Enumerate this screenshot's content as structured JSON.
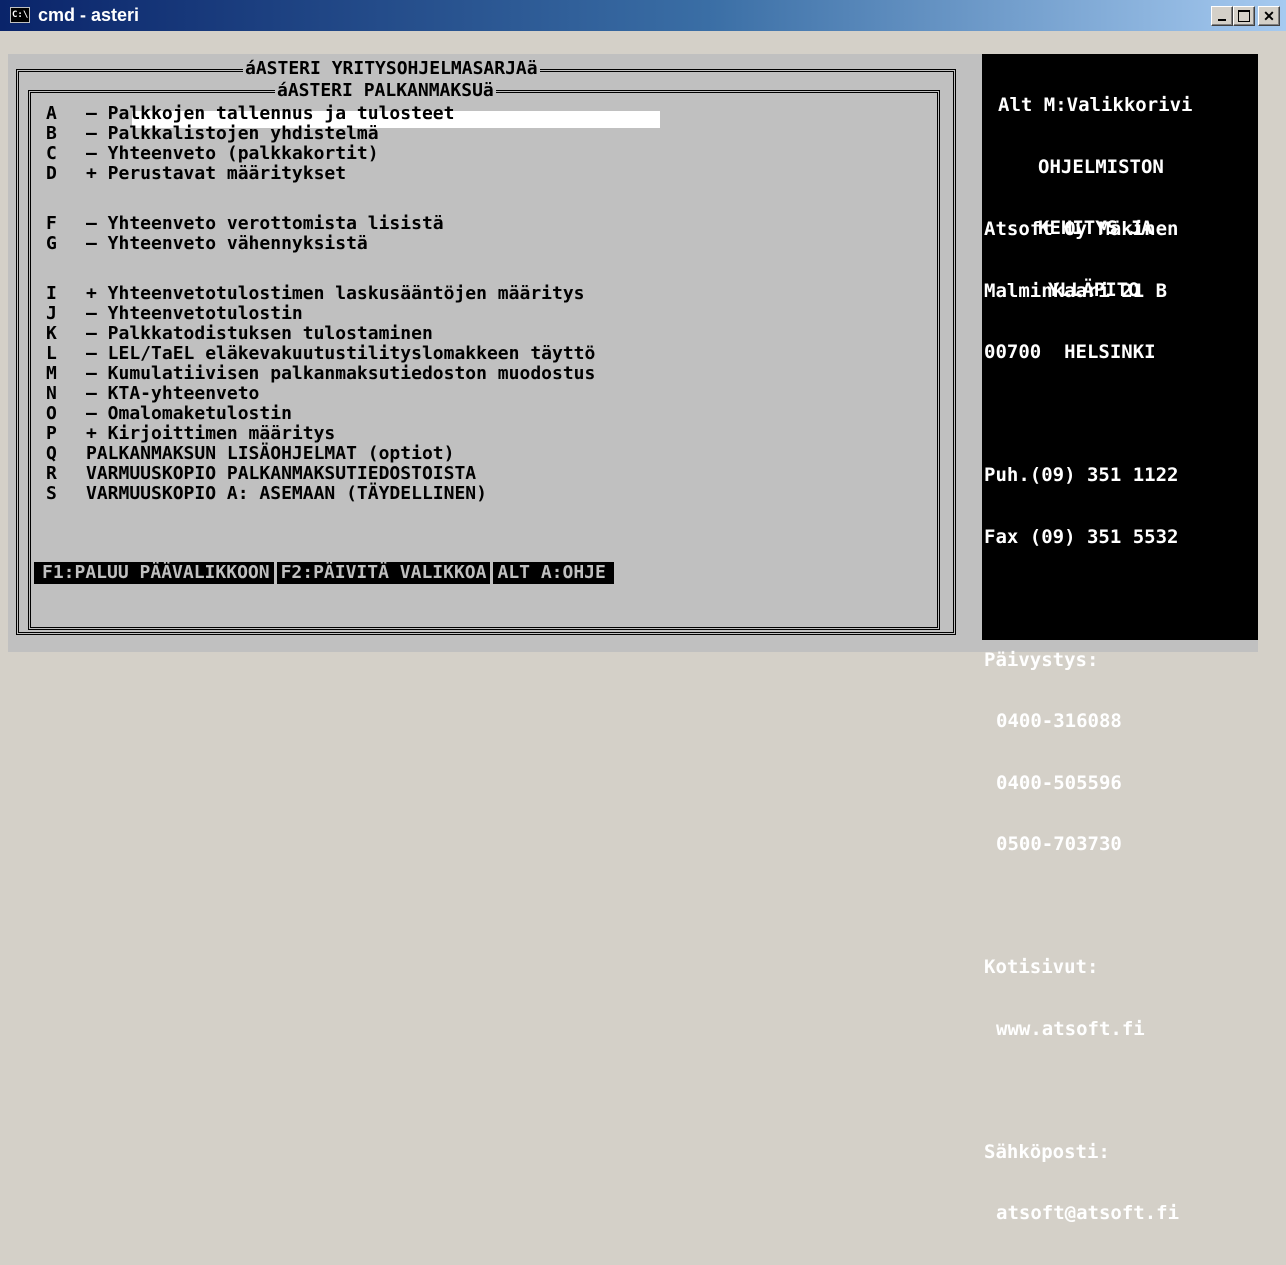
{
  "window": {
    "title": "cmd - asteri",
    "icon": "C:\\",
    "minimize_icon": "minimize-icon",
    "maximize_icon": "maximize-icon",
    "close_label": "✕"
  },
  "menu": {
    "outer_title": "áASTERI YRITYSOHJELMASARJAä",
    "inner_title": "áASTERI PALKANMAKSUä",
    "items": [
      {
        "key": "A",
        "text": "– Palkkojen tallennus ja tulosteet"
      },
      {
        "key": "B",
        "text": "– Palkkalistojen yhdistelmä"
      },
      {
        "key": "C",
        "text": "– Yhteenveto (palkkakortit)"
      },
      {
        "key": "D",
        "text": "+ Perustavat määritykset"
      },
      {
        "key": "F",
        "text": "– Yhteenveto verottomista lisistä"
      },
      {
        "key": "G",
        "text": "– Yhteenveto vähennyksistä"
      },
      {
        "key": "I",
        "text": "+ Yhteenvetotulostimen laskusääntöjen määritys"
      },
      {
        "key": "J",
        "text": "– Yhteenvetotulostin"
      },
      {
        "key": "K",
        "text": "– Palkkatodistuksen tulostaminen"
      },
      {
        "key": "L",
        "text": "– LEL/TaEL eläkevakuutustilityslomakkeen täyttö"
      },
      {
        "key": "M",
        "text": "– Kumulatiivisen palkanmaksutiedoston muodostus"
      },
      {
        "key": "N",
        "text": "– KTA-yhteenveto"
      },
      {
        "key": "O",
        "text": "– Omalomaketulostin"
      },
      {
        "key": "P",
        "text": "+ Kirjoittimen määritys"
      },
      {
        "key": "Q",
        "text": "PALKANMAKSUN LISÄOHJELMAT (optiot)"
      },
      {
        "key": "R",
        "text": "VARMUUSKOPIO PALKANMAKSUTIEDOSTOISTA"
      },
      {
        "key": "S",
        "text": "VARMUUSKOPIO A: ASEMAAN (TÄYDELLINEN)"
      }
    ],
    "function_keys": [
      "F1:PALUU PÄÄVALIKKOON",
      "F2:PÄIVITÄ VALIKKOA",
      "ALT A:OHJE"
    ]
  },
  "info": {
    "menubar_hint": "Alt M:Valikkorivi",
    "slogan": [
      "OHJELMISTON",
      "KEHITYS JA",
      "YLLÄPITO"
    ],
    "company": "Atsoft Oy Mäkinen",
    "street": "Malminkaari 21 B",
    "city": "00700  HELSINKI",
    "phone": "Puh.(09) 351 1122",
    "fax": "Fax (09) 351 5532",
    "duty_label": "Päivystys:",
    "duty_numbers": [
      "0400-316088",
      "0400-505596",
      "0500-703730"
    ],
    "web_label": "Kotisivut:",
    "web": "www.atsoft.fi",
    "email_label": "Sähköposti:",
    "email": "atsoft@atsoft.fi"
  }
}
